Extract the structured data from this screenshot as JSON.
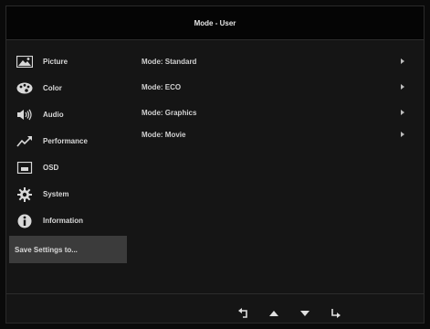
{
  "window": {
    "title": "Mode - User"
  },
  "sidebar": {
    "items": [
      {
        "label": "Picture",
        "icon": "picture-icon"
      },
      {
        "label": "Color",
        "icon": "palette-icon"
      },
      {
        "label": "Audio",
        "icon": "speaker-icon"
      },
      {
        "label": "Performance",
        "icon": "performance-icon"
      },
      {
        "label": "OSD",
        "icon": "osd-icon"
      },
      {
        "label": "System",
        "icon": "gear-icon"
      },
      {
        "label": "Information",
        "icon": "info-icon"
      }
    ],
    "save_settings": "Save Settings to..."
  },
  "main": {
    "options": [
      {
        "label": "Mode: Standard"
      },
      {
        "label": "Mode: ECO"
      },
      {
        "label": "Mode: Graphics"
      },
      {
        "label": "Mode: Movie"
      }
    ]
  },
  "navbar": {
    "buttons": [
      "back-icon",
      "up-arrow-icon",
      "down-arrow-icon",
      "enter-icon"
    ]
  },
  "colors": {
    "background": "#151515",
    "titlebar": "#050505",
    "selected": "#3b3b3b",
    "text": "#d8d8d8"
  }
}
